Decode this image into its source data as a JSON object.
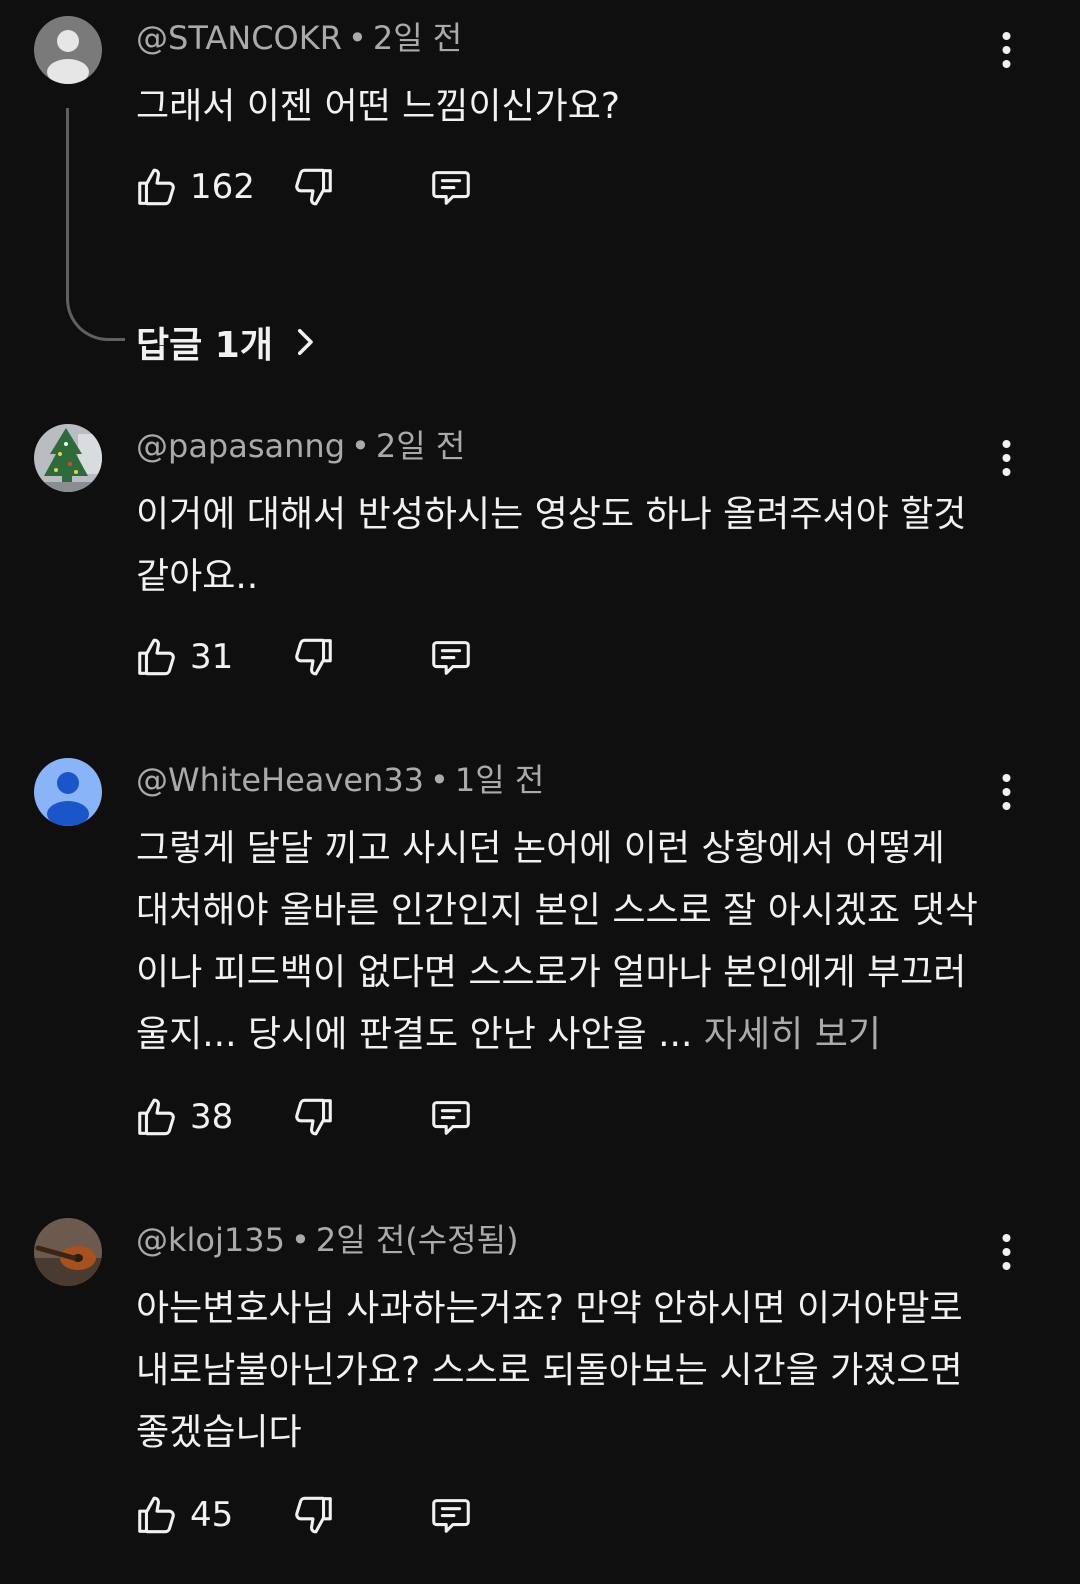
{
  "comments": [
    {
      "handle": "@STANCOKR",
      "time": "2일 전",
      "text": "그래서 이젠 어떤 느낌이신가요?",
      "likes": "162",
      "replies_label": "답글 1개",
      "avatar": "default-gray-avatar"
    },
    {
      "handle": "@papasanng",
      "time": "2일 전",
      "text": "이거에 대해서 반성하시는 영상도 하나 올려주셔야 할것 같아요..",
      "likes": "31",
      "avatar": "christmas-tree-avatar"
    },
    {
      "handle": "@WhiteHeaven33",
      "time": "1일 전",
      "text": "그렇게 달달 끼고 사시던 논어에 이런 상황에서 어떻게 대처해야 올바른 인간인지 본인 스스로 잘 아시겠죠 댓삭이나 피드백이 없다면 스스로가 얼마나 본인에게 부끄러울지... 당시에 판결도 안난 사안을 ...",
      "more_label": "자세히 보기",
      "likes": "38",
      "avatar": "default-blue-avatar"
    },
    {
      "handle": "@kloj135",
      "time": "2일 전(수정됨)",
      "text": "아는변호사님 사과하는거죠? 만약 안하시면 이거야말로 내로남불아닌가요? 스스로 되돌아보는 시간을 가졌으면 좋겠습니다",
      "likes": "45",
      "avatar": "guitar-photo-avatar"
    }
  ],
  "separator": "•",
  "colors": {
    "background": "#0f0f0f",
    "text": "#f1f1f1",
    "secondary": "#aaaaaa",
    "thread_line": "#606060",
    "blue_avatar": "#8ab4f8"
  },
  "icons": [
    "thumbs-up-icon",
    "thumbs-down-icon",
    "reply-icon",
    "more-vert-icon",
    "chevron-right-icon"
  ]
}
